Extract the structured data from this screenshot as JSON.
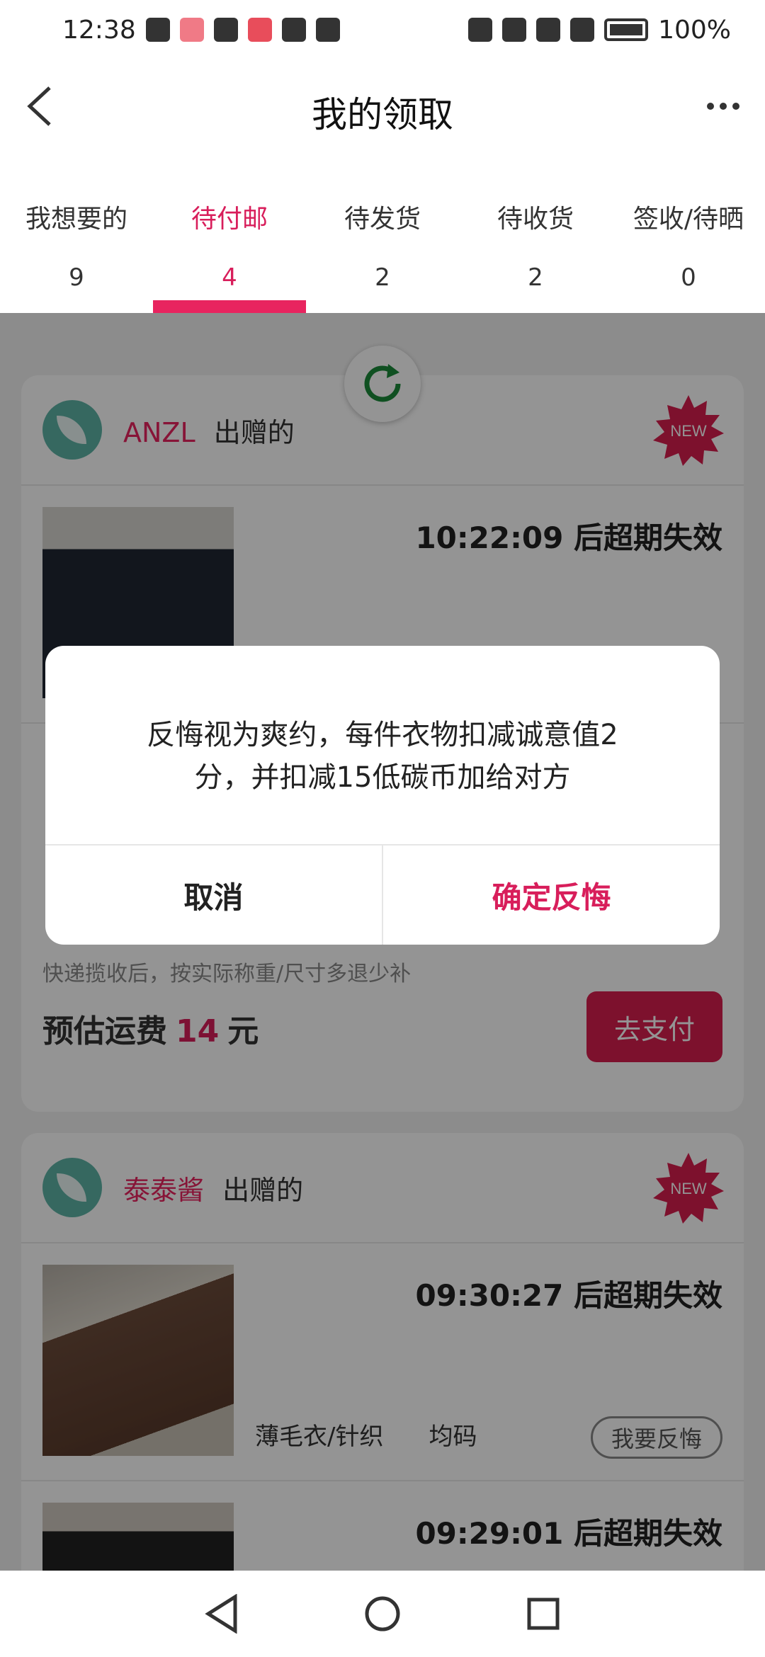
{
  "status_bar": {
    "time": "12:38",
    "battery": "100%"
  },
  "header": {
    "title": "我的领取",
    "back_icon": "chevron-left-icon",
    "more_icon": "more-dots-icon"
  },
  "tabs": [
    {
      "label": "我想要的",
      "count": "9"
    },
    {
      "label": "待付邮",
      "count": "4"
    },
    {
      "label": "待发货",
      "count": "2"
    },
    {
      "label": "待收货",
      "count": "2"
    },
    {
      "label": "签收/待晒",
      "count": "0"
    }
  ],
  "card1": {
    "giver_name": "ANZL",
    "giver_suffix": "出赠的",
    "badge": "NEW",
    "item_timer": "10:22:09 后超期失效",
    "ship_note": "快递揽收后，按实际称重/尺寸多退少补",
    "fee_prefix": "预估运费",
    "fee_amount": "14",
    "fee_unit": "元",
    "pay_label": "去支付"
  },
  "card2": {
    "giver_name": "泰泰酱",
    "giver_suffix": "出赠的",
    "badge": "NEW",
    "item1": {
      "timer": "09:30:27 后超期失效",
      "category": "薄毛衣/针织",
      "size": "均码",
      "regret_label": "我要反悔"
    },
    "item2": {
      "timer": "09:29:01 后超期失效"
    }
  },
  "dialog": {
    "message": "反悔视为爽约，每件衣物扣减诚意值2分，并扣减15低碳币加给对方",
    "cancel": "取消",
    "confirm": "确定反悔"
  },
  "colors": {
    "accent": "#e8245f",
    "pay_button": "#d81e4e",
    "avatar": "#5eb3a6"
  }
}
